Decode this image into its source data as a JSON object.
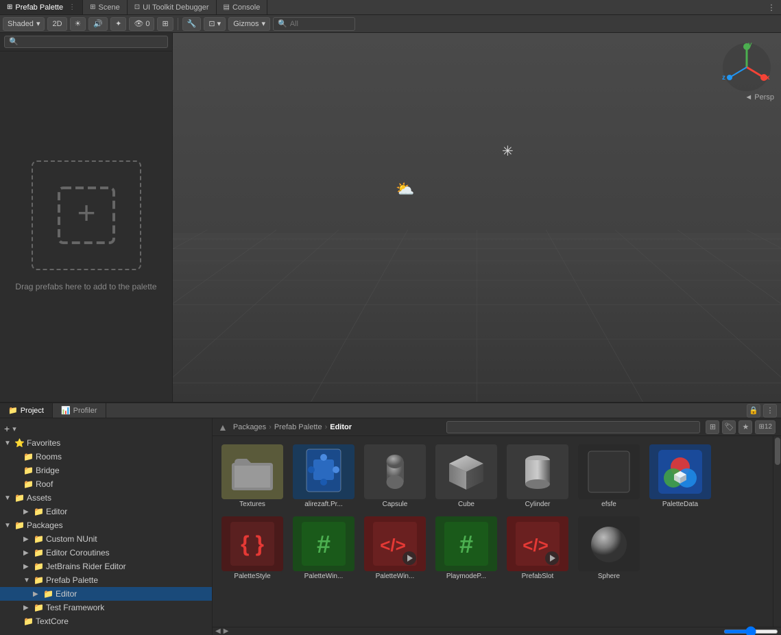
{
  "tabs": {
    "prefab_palette": "Prefab Palette",
    "scene": "Scene",
    "ui_toolkit": "UI Toolkit Debugger",
    "console": "Console"
  },
  "toolbar": {
    "shaded_label": "Shaded",
    "two_d_label": "2D",
    "gizmos_label": "Gizmos",
    "all_label": "All",
    "persp_label": "◄ Persp"
  },
  "palette": {
    "title": "Prefab Palette",
    "search_placeholder": "🔍",
    "drop_text": "Drag prefabs here to add to the palette"
  },
  "project": {
    "tab_project": "Project",
    "tab_profiler": "Profiler",
    "breadcrumbs": [
      "Packages",
      "Prefab Palette",
      "Editor"
    ],
    "search_placeholder": ""
  },
  "tree": {
    "favorites_label": "Favorites",
    "rooms_label": "Rooms",
    "bridge_label": "Bridge",
    "roof_label": "Roof",
    "assets_label": "Assets",
    "editor_label": "Editor",
    "packages_label": "Packages",
    "custom_nunit_label": "Custom NUnit",
    "editor_coroutines_label": "Editor Coroutines",
    "jetbrains_label": "JetBrains Rider Editor",
    "prefab_palette_label": "Prefab Palette",
    "prefab_editor_label": "Editor",
    "test_framework_label": "Test Framework",
    "textcore_label": "TextCore"
  },
  "files": [
    {
      "name": "Textures",
      "type": "folder"
    },
    {
      "name": "alirezaft.Pr...",
      "type": "prefab"
    },
    {
      "name": "Capsule",
      "type": "capsule"
    },
    {
      "name": "Cube",
      "type": "cube"
    },
    {
      "name": "Cylinder",
      "type": "cylinder"
    },
    {
      "name": "efsfe",
      "type": "dark"
    },
    {
      "name": "PaletteData",
      "type": "palette-data"
    },
    {
      "name": "PaletteStyle",
      "type": "script-red"
    },
    {
      "name": "PaletteWin...",
      "type": "script-hash"
    },
    {
      "name": "PaletteWin...",
      "type": "script-play"
    },
    {
      "name": "PlaymodeP...",
      "type": "script-hash2"
    },
    {
      "name": "PrefabSlot",
      "type": "script-play2"
    },
    {
      "name": "Sphere",
      "type": "sphere"
    }
  ],
  "bottom_actions": {
    "add_label": "+",
    "count_label": "12"
  }
}
